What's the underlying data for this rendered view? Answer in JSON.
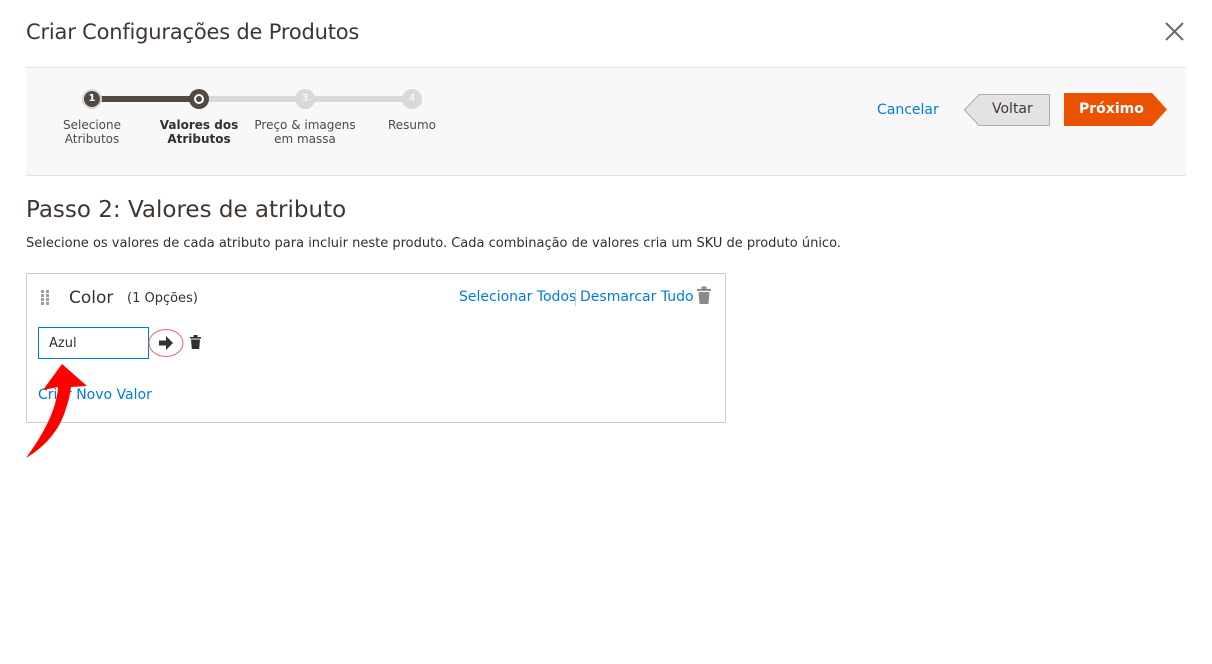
{
  "modal": {
    "title": "Criar Configurações de Produtos"
  },
  "wizard": {
    "steps": [
      {
        "number": "1",
        "label": "Selecione Atributos",
        "state": "done"
      },
      {
        "number": "2",
        "label": "Valores dos Atributos",
        "state": "current"
      },
      {
        "number": "3",
        "label": "Preço & imagens em massa",
        "state": "todo"
      },
      {
        "number": "4",
        "label": "Resumo",
        "state": "todo"
      }
    ],
    "cancel_label": "Cancelar",
    "back_label": "Voltar",
    "next_label": "Próximo"
  },
  "content": {
    "heading": "Passo 2: Valores de atributo",
    "description": "Selecione os valores de cada atributo para incluir neste produto. Cada combinação de valores cria um SKU de produto único."
  },
  "attribute": {
    "name": "Color",
    "count_label": "(1 Opções)",
    "select_all_label": "Selecionar Todos",
    "deselect_all_label": "Desmarcar Tudo",
    "new_value_input": "Azul",
    "create_value_label": "Criar Novo Valor"
  },
  "colors": {
    "accent_link": "#007bdb",
    "primary_button": "#eb5202",
    "annotation_arrow": "#ff0000"
  },
  "icons": [
    "close-icon",
    "drag-handle-icon",
    "trash-icon",
    "arrow-right-icon",
    "annotation-arrow"
  ]
}
